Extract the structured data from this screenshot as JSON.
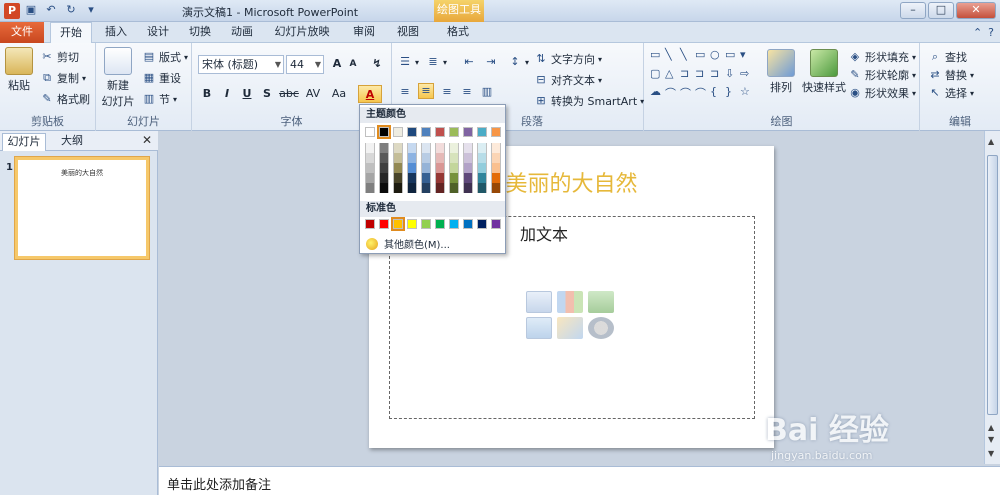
{
  "titlebar": {
    "title": "演示文稿1  -  Microsoft PowerPoint",
    "context_tab": "绘图工具",
    "app_icon": "P"
  },
  "tabs": {
    "file": "文件",
    "items": [
      "开始",
      "插入",
      "设计",
      "切换",
      "动画",
      "幻灯片放映",
      "审阅",
      "视图",
      "格式"
    ],
    "active": "开始"
  },
  "ribbon": {
    "clipboard": {
      "label": "剪贴板",
      "paste": "粘贴",
      "cut": "剪切",
      "copy": "复制",
      "format_painter": "格式刷"
    },
    "slides": {
      "label": "幻灯片",
      "new_slide": "新建",
      "new_slide2": "幻灯片",
      "layout": "版式",
      "reset": "重设",
      "section": "节"
    },
    "font": {
      "label": "字体",
      "font_name": "宋体 (标题)",
      "font_size": "44",
      "grow": "A",
      "shrink": "A",
      "bold": "B",
      "italic": "I",
      "underline": "U",
      "shadow": "S",
      "strike": "abc",
      "spacing": "AV",
      "case": "Aa",
      "font_color": "A"
    },
    "paragraph": {
      "label": "段落",
      "text_direction": "文字方向",
      "align_text": "对齐文本",
      "smartart": "转换为 SmartArt"
    },
    "drawing": {
      "label": "绘图",
      "arrange": "排列",
      "quick_styles": "快速样式",
      "shape_fill": "形状填充",
      "shape_outline": "形状轮廓",
      "shape_effects": "形状效果"
    },
    "editing": {
      "label": "编辑",
      "find": "查找",
      "replace": "替换",
      "select": "选择"
    }
  },
  "leftpane": {
    "tab_slides": "幻灯片",
    "tab_outline": "大纲",
    "close": "✕",
    "thumb_number": "1",
    "thumb_title": "美丽的大自然"
  },
  "slide": {
    "title": "美丽的大自然",
    "content_text": "加文本"
  },
  "notes": {
    "placeholder": "单击此处添加备注"
  },
  "color_dropdown": {
    "theme_header": "主题颜色",
    "standard_header": "标准色",
    "more_colors": "其他颜色(M)...",
    "theme_colors": [
      "#ffffff",
      "#000000",
      "#eeece1",
      "#1f497d",
      "#4f81bd",
      "#c0504d",
      "#9bbb59",
      "#8064a2",
      "#4bacc6",
      "#f79646"
    ],
    "shade_columns": [
      [
        "#f2f2f2",
        "#d8d8d8",
        "#bfbfbf",
        "#a5a5a5",
        "#7f7f7f"
      ],
      [
        "#7f7f7f",
        "#595959",
        "#3f3f3f",
        "#262626",
        "#0c0c0c"
      ],
      [
        "#ddd9c3",
        "#c4bd97",
        "#938953",
        "#494429",
        "#1d1b10"
      ],
      [
        "#c6d9f0",
        "#8db3e2",
        "#548dd4",
        "#17365d",
        "#0f243e"
      ],
      [
        "#dbe5f1",
        "#b8cce4",
        "#95b3d7",
        "#366092",
        "#244061"
      ],
      [
        "#f2dcdb",
        "#e5b9b7",
        "#d99694",
        "#953734",
        "#632423"
      ],
      [
        "#ebf1dd",
        "#d7e3bc",
        "#c3d69b",
        "#76923c",
        "#4f6128"
      ],
      [
        "#e5e0ec",
        "#ccc1d9",
        "#b2a2c7",
        "#5f497a",
        "#3f3151"
      ],
      [
        "#dbeef3",
        "#b7dde8",
        "#92cddc",
        "#31859b",
        "#205867"
      ],
      [
        "#fdeada",
        "#fbd5b5",
        "#fac08f",
        "#e36c09",
        "#974806"
      ]
    ],
    "standard_colors": [
      "#c00000",
      "#ff0000",
      "#ffc000",
      "#ffff00",
      "#92d050",
      "#00b050",
      "#00b0f0",
      "#0070c0",
      "#002060",
      "#7030a0"
    ]
  },
  "watermark": {
    "brand": "Bai 经验",
    "url": "jingyan.baidu.com"
  }
}
